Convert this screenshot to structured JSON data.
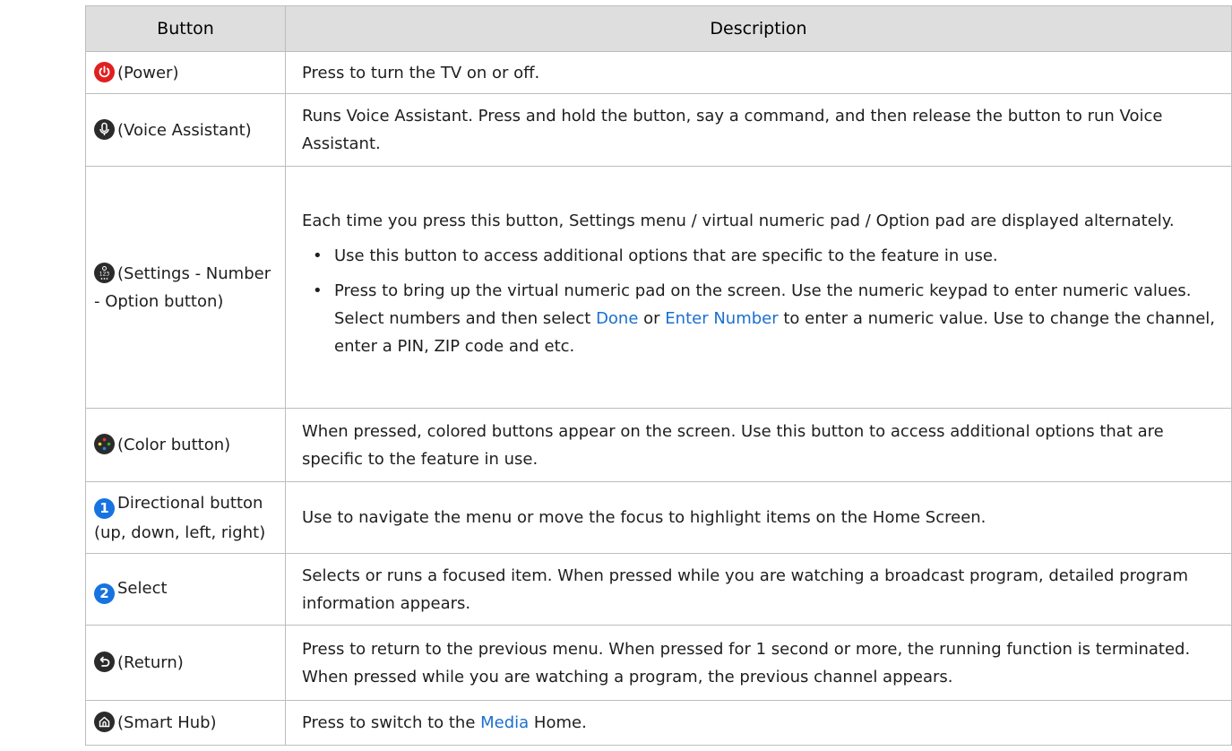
{
  "headers": {
    "button": "Button",
    "description": "Description"
  },
  "colors": {
    "header_bg": "#dedede",
    "border": "#bdbdbd",
    "link": "#1a6fd0",
    "power_icon": "#e02020",
    "dark_icon": "#2b2b2b",
    "number_badge": "#1673e0"
  },
  "rows": [
    {
      "icon": "power-icon",
      "label": "(Power)",
      "description": "Press to turn the TV on or off."
    },
    {
      "icon": "microphone-icon",
      "label": "(Voice Assistant)",
      "description": "Runs Voice Assistant. Press and hold the button, say a command, and then release the button to run Voice Assistant."
    },
    {
      "icon": "settings-number-icon",
      "label": "(Settings - Number - Option button)",
      "description_intro": "Each time you press this button, Settings menu / virtual numeric pad / Option pad are displayed alternately.",
      "bullet1": "Use this button to access additional options that are specific to the feature in use.",
      "bullet2_part1": "Press to bring up the virtual numeric pad on the screen. Use the numeric keypad to enter numeric values. Select numbers and then select ",
      "bullet2_link1": "Done",
      "bullet2_part2": " or ",
      "bullet2_link2": "Enter Number",
      "bullet2_part3": " to enter a numeric value. Use to change the channel, enter a PIN, ZIP code and etc."
    },
    {
      "icon": "color-button-icon",
      "label": "(Color button)",
      "description": "When pressed, colored buttons appear on the screen. Use this button to access additional options that are specific to the feature in use."
    },
    {
      "icon": "number-1-badge-icon",
      "badge": "1",
      "label": "Directional button (up, down, left, right)",
      "description": "Use to navigate the menu or move the focus to highlight items on the Home Screen."
    },
    {
      "icon": "number-2-badge-icon",
      "badge": "2",
      "label": "Select",
      "description": "Selects or runs a focused item. When pressed while you are watching a broadcast program, detailed program information appears."
    },
    {
      "icon": "return-icon",
      "label": "(Return)",
      "description": "Press to return to the previous menu. When pressed for 1 second or more, the running function is terminated. When pressed while you are watching a program, the previous channel appears."
    },
    {
      "icon": "home-icon",
      "label": "(Smart Hub)",
      "desc_part1": "Press to switch to the ",
      "desc_link": "Media",
      "desc_part2": " Home."
    }
  ]
}
